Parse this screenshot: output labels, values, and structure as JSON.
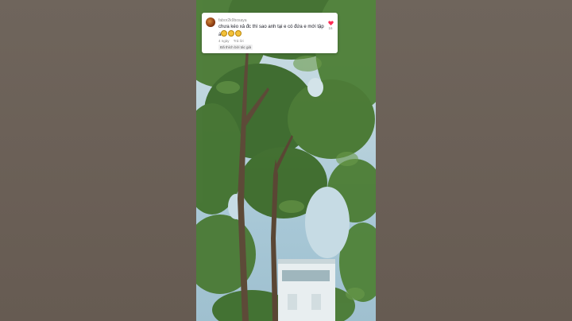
{
  "comment": {
    "username": "fabor2k9bosaya",
    "text": "chưa kéo xả đc thì sao anh tại e có đứa e mới tập",
    "emoji_prefix": "á",
    "emojis": [
      "laughing-face-icon",
      "laughing-face-icon",
      "laughing-face-icon"
    ],
    "time": "4 ngày",
    "reply_label": "Trả lời",
    "creator_tag": "Đã thích bởi tác giả",
    "like_count": "16",
    "like_color": "#fe2c55"
  },
  "colors": {
    "side_background": "#6d6259",
    "sky": "#b9d2dc",
    "foliage": "#3f6b2c"
  }
}
